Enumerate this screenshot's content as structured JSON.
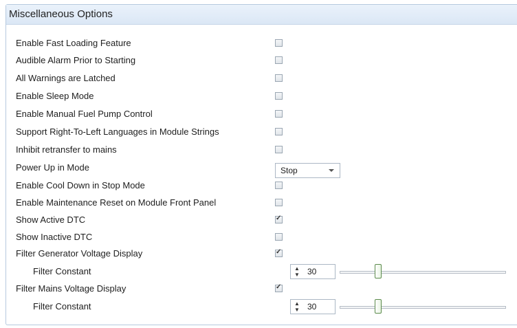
{
  "panel": {
    "title": "Miscellaneous Options"
  },
  "options": [
    {
      "label": "Enable Fast Loading Feature",
      "checked": false
    },
    {
      "label": "Audible Alarm Prior to Starting",
      "checked": false
    },
    {
      "label": "All Warnings are Latched",
      "checked": false
    },
    {
      "label": "Enable Sleep Mode",
      "checked": false
    },
    {
      "label": "Enable Manual Fuel Pump Control",
      "checked": false
    },
    {
      "label": "Support Right-To-Left Languages in Module Strings",
      "checked": false
    },
    {
      "label": "Inhibit retransfer to mains",
      "checked": false
    },
    {
      "label": "Power Up in Mode",
      "value": "Stop"
    },
    {
      "label": "Enable Cool Down in Stop Mode",
      "checked": false
    },
    {
      "label": "Enable Maintenance Reset on Module Front Panel",
      "checked": false
    },
    {
      "label": "Show Active DTC",
      "checked": true
    },
    {
      "label": "Show Inactive DTC",
      "checked": false
    },
    {
      "label": "Filter Generator Voltage Display",
      "checked": true
    },
    {
      "label": "Filter Constant",
      "value": "30",
      "slider_fraction": 0.22
    },
    {
      "label": "Filter Mains Voltage Display",
      "checked": true
    },
    {
      "label": "Filter Constant",
      "value": "30",
      "slider_fraction": 0.22
    }
  ]
}
